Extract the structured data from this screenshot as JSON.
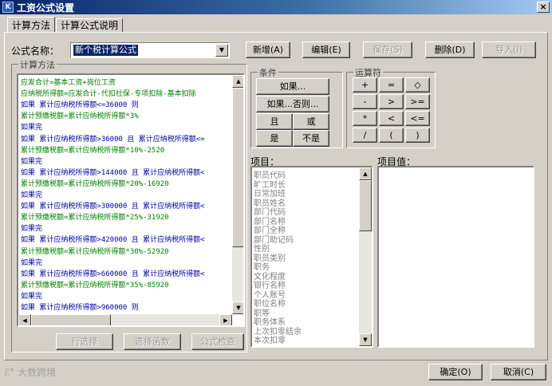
{
  "window": {
    "title": "工资公式设置",
    "icon": "app-logo-icon",
    "close_label": "×"
  },
  "tabs": [
    {
      "label": "计算方法"
    },
    {
      "label": "计算公式说明"
    }
  ],
  "formula_name": {
    "label": "公式名称：",
    "value": "新个税计算公式"
  },
  "toolbar": {
    "add": "新增(A)",
    "edit": "编辑(E)",
    "save": "保存(S)",
    "delete": "删除(D)",
    "import": "导入(I)"
  },
  "method_group": "计算方法",
  "formula_lines": [
    "应发合计=基本工资+岗位工资",
    "应纳税所得额=应发合计-代扣社保-专项扣除-基本扣除",
    "如果 累计应纳税所得额<=36000 则",
    "   累计预缴税额=累计应纳税所得额*3%",
    "如果完",
    "如果 累计应纳税所得额>36000 且 累计应纳税所得额<=",
    "   累计预缴税额=累计应纳税所得额*10%-2520",
    "如果完",
    "如果 累计应纳税所得额>144000 且 累计应纳税所得额<",
    "   累计预缴税额=累计应纳税所得额*20%-16920",
    "如果完",
    "如果 累计应纳税所得额>300000 且 累计应纳税所得额<",
    "   累计预缴税额=累计应纳税所得额*25%-31920",
    "如果完",
    "如果 累计应纳税所得额>420000 且 累计应纳税所得额<",
    "   累计预缴税额=累计应纳税所得额*30%-52920",
    "如果完",
    "如果 累计应纳税所得额>660000 且 累计应纳税所得额<",
    "   累计预缴税额=累计应纳税所得额*35%-85920",
    "如果完",
    "如果 累计应纳税所得额>960000 则"
  ],
  "bottom_buttons": {
    "row_select": "行选择",
    "select_func": "选择函数",
    "check": "公式检查"
  },
  "condition_group": {
    "title": "条件",
    "if": "如果...",
    "if_else": "如果...否则...",
    "and": "且",
    "or": "或",
    "yes": "是",
    "not": "不是"
  },
  "operator_group": {
    "title": "运算符",
    "ops": [
      "+",
      "=",
      "◇",
      "-",
      ">",
      ">=",
      "*",
      "<",
      "<=",
      "/",
      "(",
      ")"
    ]
  },
  "items_label": "项目：",
  "items": [
    "职员代码",
    "旷工时长",
    "日常加班",
    "职员姓名",
    "部门代码",
    "部门名称",
    "部门全称",
    "部门助记码",
    "性别",
    "职员类别",
    "职务",
    "文化程度",
    "银行名称",
    "个人账号",
    "职位名称",
    "职等",
    "职务体系",
    "上次扣零结余",
    "本次扣零"
  ],
  "item_value_label": "项目值：",
  "footer": {
    "ok": "确定(O)",
    "cancel": "取消(C)",
    "brand": "大数跨境"
  }
}
